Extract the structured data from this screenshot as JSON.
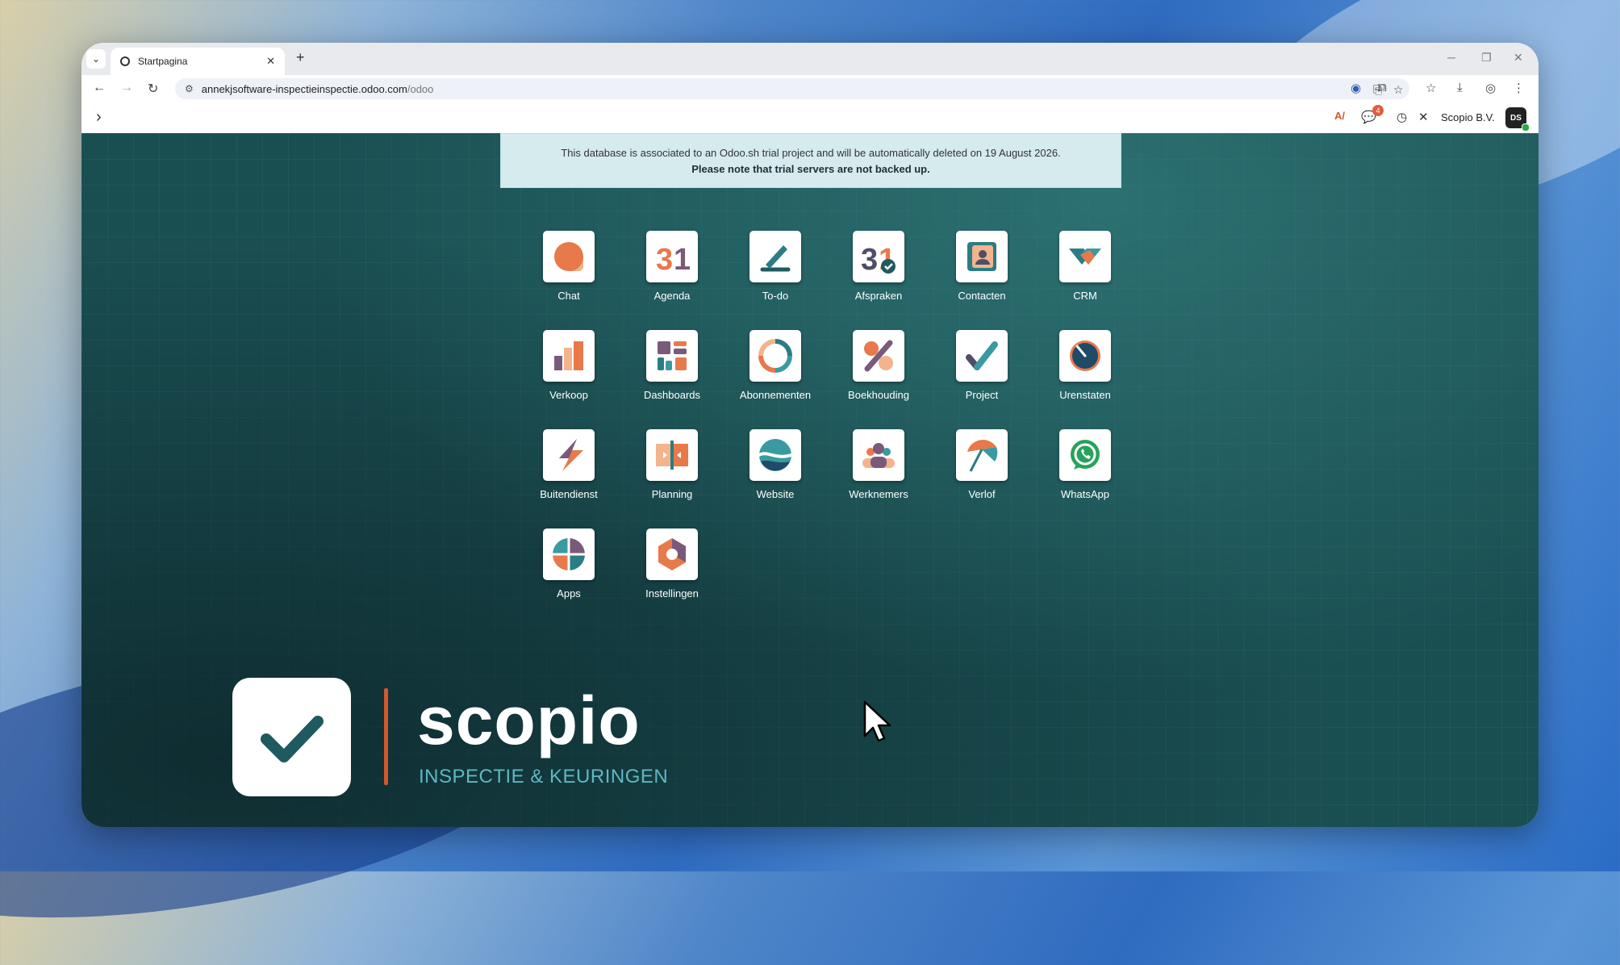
{
  "browser": {
    "tab_title": "Startpagina",
    "url_host": "annekjsoftware-inspectieinspectie.odoo.com",
    "url_path": "/odoo",
    "icons": [
      "back-icon",
      "forward-icon",
      "reload-icon",
      "site-info-icon",
      "install-app-icon",
      "bookmark-star-icon",
      "password-manager-icon",
      "extensions-icon",
      "bookmarks-icon",
      "downloads-icon",
      "profile-icon",
      "menu-icon"
    ]
  },
  "odoo_nav": {
    "company": "Scopio B.V.",
    "avatar_initials": "DS",
    "message_badge": "4"
  },
  "banner": {
    "line1": "This database is associated to an Odoo.sh trial project and will be automatically deleted on 19 August 2026.",
    "line2": "Please note that trial servers are not backed up."
  },
  "apps": [
    {
      "label": "Chat",
      "icon": "chat-icon"
    },
    {
      "label": "Agenda",
      "icon": "calendar-icon"
    },
    {
      "label": "To-do",
      "icon": "todo-icon"
    },
    {
      "label": "Afspraken",
      "icon": "appointments-icon"
    },
    {
      "label": "Contacten",
      "icon": "contacts-icon"
    },
    {
      "label": "CRM",
      "icon": "crm-icon"
    },
    {
      "label": "Verkoop",
      "icon": "sales-icon"
    },
    {
      "label": "Dashboards",
      "icon": "dashboards-icon"
    },
    {
      "label": "Abonnementen",
      "icon": "subscriptions-icon"
    },
    {
      "label": "Boekhouding",
      "icon": "accounting-icon"
    },
    {
      "label": "Project",
      "icon": "project-icon"
    },
    {
      "label": "Urenstaten",
      "icon": "timesheets-icon"
    },
    {
      "label": "Buitendienst",
      "icon": "field-service-icon"
    },
    {
      "label": "Planning",
      "icon": "planning-icon"
    },
    {
      "label": "Website",
      "icon": "website-icon"
    },
    {
      "label": "Werknemers",
      "icon": "employees-icon"
    },
    {
      "label": "Verlof",
      "icon": "time-off-icon"
    },
    {
      "label": "WhatsApp",
      "icon": "whatsapp-icon"
    },
    {
      "label": "Apps",
      "icon": "apps-icon"
    },
    {
      "label": "Instellingen",
      "icon": "settings-icon"
    }
  ],
  "logo": {
    "word": "scopio",
    "tagline": "INSPECTIE & KEURINGEN",
    "accent": "#d2582f",
    "brand_teal": "#1f5a60"
  }
}
